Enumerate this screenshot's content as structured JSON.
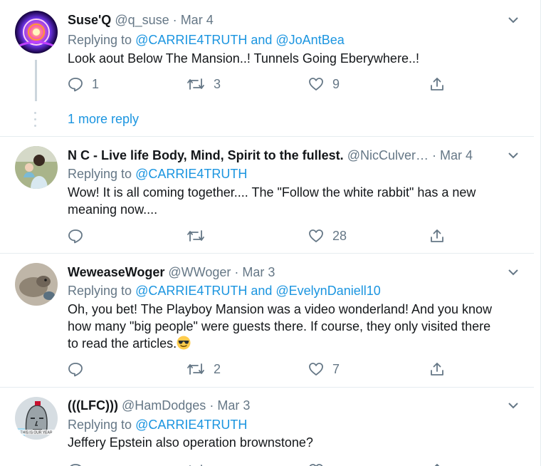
{
  "tweets": [
    {
      "name": "Suse'Q",
      "handle": "@q_suse",
      "date": "Mar 4",
      "replying_prefix": "Replying to",
      "replying_to": "@CARRIE4TRUTH and @JoAntBea",
      "text": "Look aout Below The Mansion..! Tunnels Going Eberywhere..!",
      "replies": "1",
      "retweets": "3",
      "likes": "9"
    },
    {
      "name": "N C - Live life Body, Mind, Spirit to the fullest.",
      "handle": "@NicCulver…",
      "date": "Mar 4",
      "replying_prefix": "Replying to",
      "replying_to": "@CARRIE4TRUTH",
      "text_line1": "Wow!  It is all coming together.... The \"Follow the white rabbit\" has a new",
      "text_line2": "meaning now....",
      "replies": "",
      "retweets": "",
      "likes": "28"
    },
    {
      "name": "WeweaseWoger",
      "handle": "@WWoger",
      "date": "Mar 3",
      "replying_prefix": "Replying to",
      "replying_to": "@CARRIE4TRUTH and @EvelynDaniell10",
      "text_line1": "Oh, you bet! The Playboy Mansion was a video wonderland! And you know",
      "text_line2": "how many \"big people\" were guests there. If course, they only visited there",
      "text_line3": "to read the articles.",
      "emoji": "sunglasses-emoji",
      "replies": "",
      "retweets": "2",
      "likes": "7"
    },
    {
      "name": "(((LFC)))",
      "handle": "@HamDodges",
      "date": "Mar 3",
      "replying_prefix": "Replying to",
      "replying_to": "@CARRIE4TRUTH",
      "text": "Jeffery Epstein also operation brownstone?",
      "avatar_caption": "THIS IS OUR YEAR"
    }
  ],
  "more_replies": "1 more reply",
  "dot": "·",
  "colors": {
    "link": "#1b95e0",
    "secondary": "#657786",
    "border": "#e6ecf0"
  }
}
